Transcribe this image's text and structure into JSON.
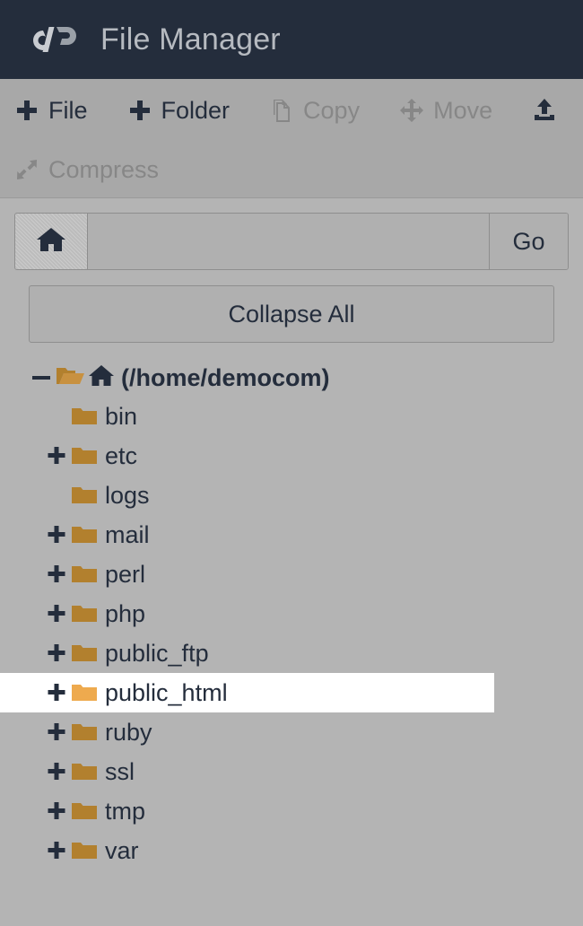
{
  "header": {
    "logo_icon": "cpanel-logo-icon",
    "title": "File Manager",
    "bg_color": "#242d3c",
    "title_color": "#b6bac0"
  },
  "toolbar": {
    "rows": [
      [
        {
          "id": "new-file",
          "label": "File",
          "icon": "plus-icon",
          "enabled": true
        },
        {
          "id": "new-folder",
          "label": "Folder",
          "icon": "plus-icon",
          "enabled": true
        },
        {
          "id": "copy",
          "label": "Copy",
          "icon": "copy-pages-icon",
          "enabled": false
        },
        {
          "id": "move",
          "label": "Move",
          "icon": "move-arrows-icon",
          "enabled": false
        },
        {
          "id": "upload",
          "label": "",
          "icon": "upload-icon",
          "enabled": true
        }
      ],
      [
        {
          "id": "compress",
          "label": "Compress",
          "icon": "compress-arrows-icon",
          "enabled": false
        }
      ]
    ],
    "bg_color": "#a8a8a8",
    "enabled_color": "#242d3c",
    "disabled_color": "#878787"
  },
  "path_bar": {
    "home_icon": "home-icon",
    "input_value": "",
    "input_placeholder": "",
    "go_label": "Go"
  },
  "collapse_all": {
    "label": "Collapse All"
  },
  "tree": {
    "root": {
      "expander": "minus-icon",
      "folder_icon": "open-folder-icon",
      "home_icon": "home-icon",
      "label": "(/home/democom)"
    },
    "folder_color": "#b2802e",
    "folder_color_selected": "#eeaa4e",
    "items": [
      {
        "label": "bin",
        "expandable": false,
        "selected": false
      },
      {
        "label": "etc",
        "expandable": true,
        "selected": false
      },
      {
        "label": "logs",
        "expandable": false,
        "selected": false
      },
      {
        "label": "mail",
        "expandable": true,
        "selected": false
      },
      {
        "label": "perl",
        "expandable": true,
        "selected": false
      },
      {
        "label": "php",
        "expandable": true,
        "selected": false
      },
      {
        "label": "public_ftp",
        "expandable": true,
        "selected": false
      },
      {
        "label": "public_html",
        "expandable": true,
        "selected": true
      },
      {
        "label": "ruby",
        "expandable": true,
        "selected": false
      },
      {
        "label": "ssl",
        "expandable": true,
        "selected": false
      },
      {
        "label": "tmp",
        "expandable": true,
        "selected": false
      },
      {
        "label": "var",
        "expandable": true,
        "selected": false
      }
    ]
  }
}
